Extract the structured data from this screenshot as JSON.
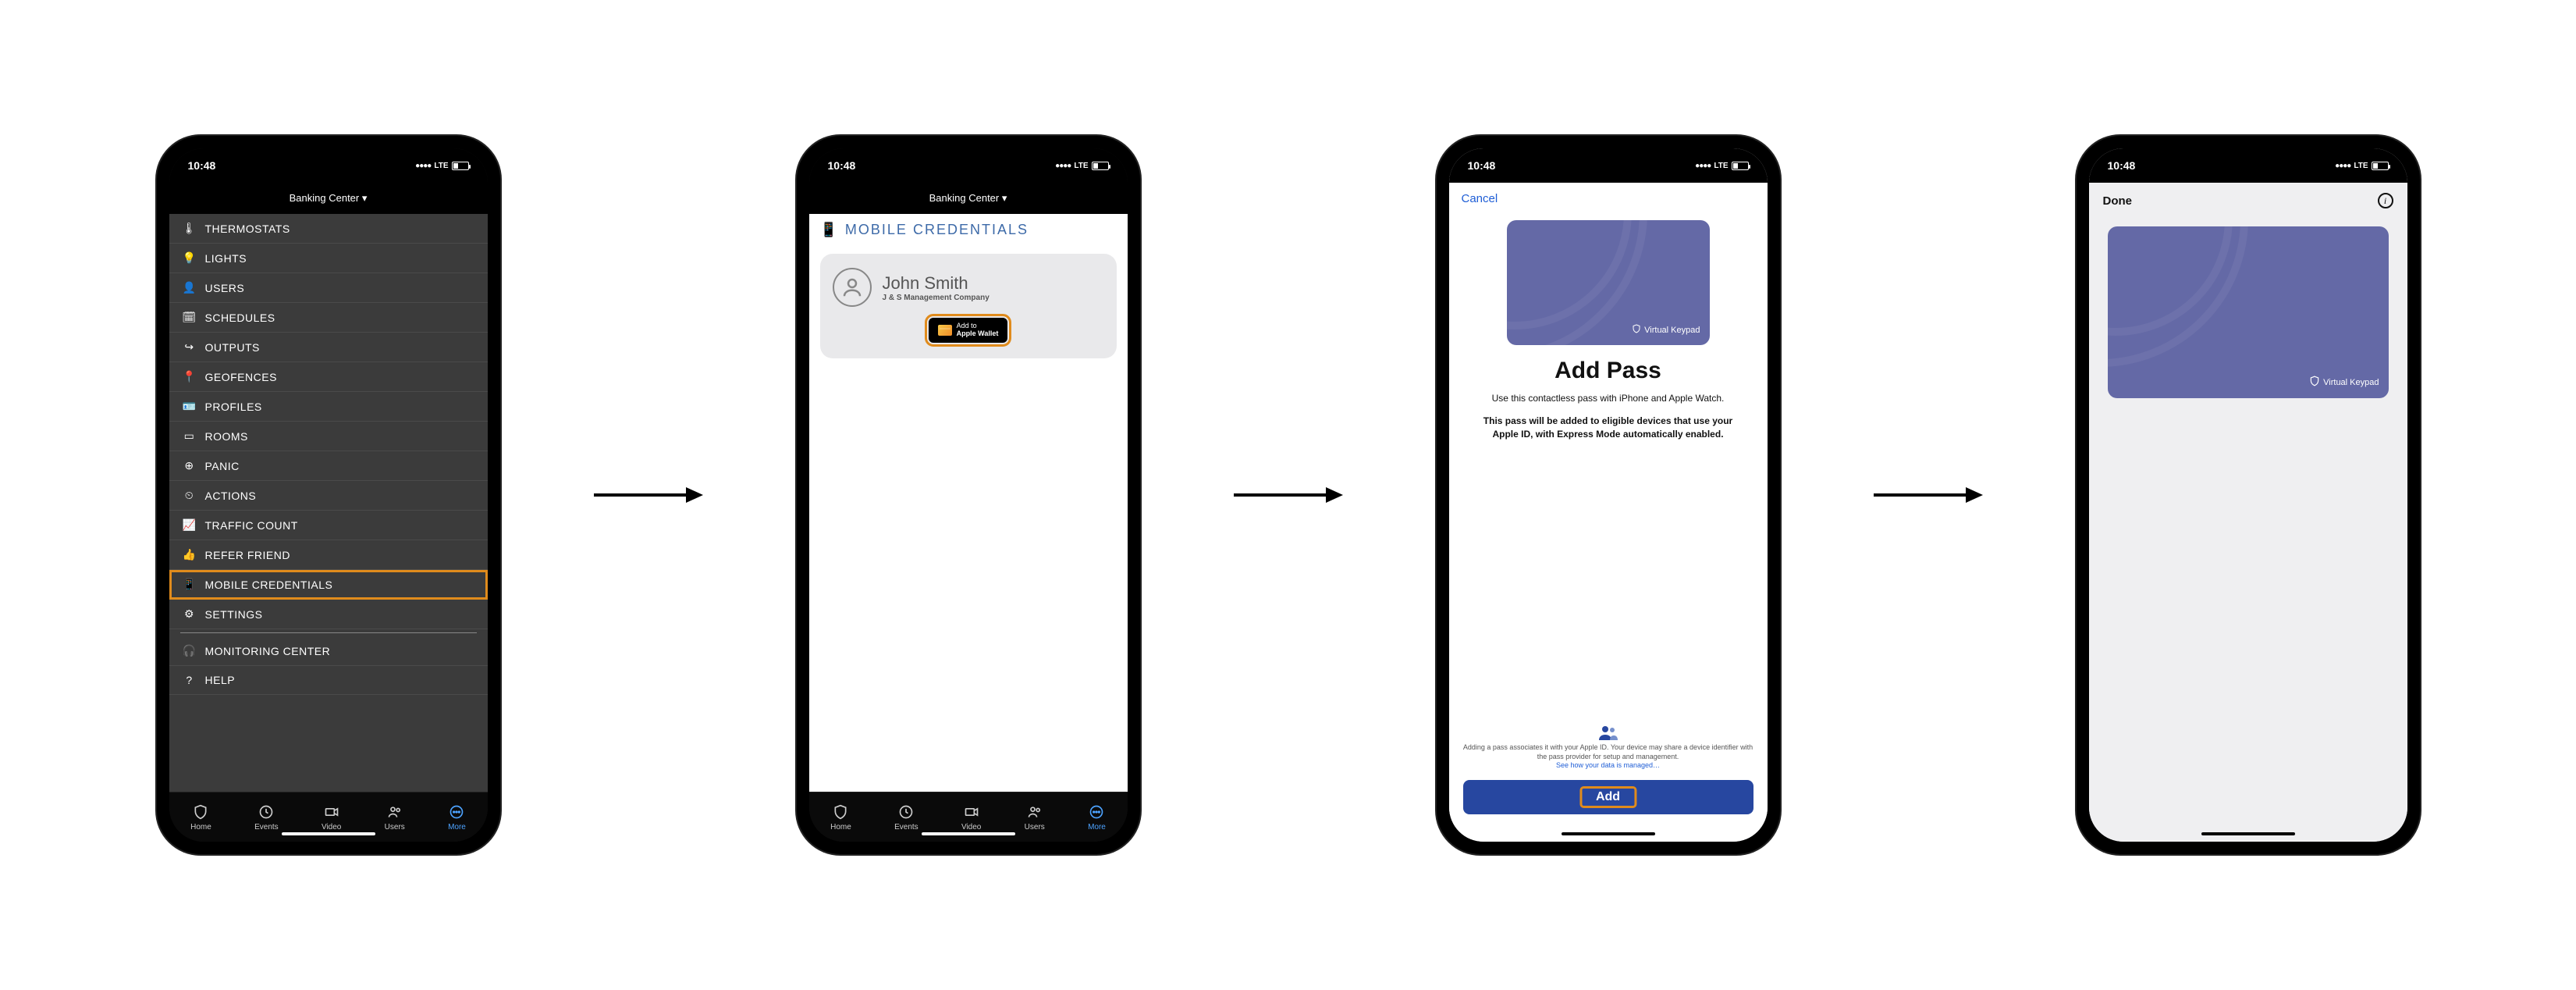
{
  "status": {
    "time": "10:48",
    "network": "LTE",
    "signal": "●●●●"
  },
  "header": {
    "location": "Banking Center ▾"
  },
  "menu": {
    "items": [
      {
        "icon": "thermometer-icon",
        "glyph": "🌡",
        "label": "THERMOSTATS"
      },
      {
        "icon": "lightbulb-icon",
        "glyph": "💡",
        "label": "LIGHTS"
      },
      {
        "icon": "user-icon",
        "glyph": "👤",
        "label": "USERS"
      },
      {
        "icon": "calendar-icon",
        "glyph": "🗓",
        "label": "SCHEDULES"
      },
      {
        "icon": "output-icon",
        "glyph": "↪",
        "label": "OUTPUTS"
      },
      {
        "icon": "pin-icon",
        "glyph": "📍",
        "label": "GEOFENCES"
      },
      {
        "icon": "card-icon",
        "glyph": "🪪",
        "label": "PROFILES"
      },
      {
        "icon": "room-icon",
        "glyph": "▭",
        "label": "ROOMS"
      },
      {
        "icon": "alert-icon",
        "glyph": "⊕",
        "label": "PANIC"
      },
      {
        "icon": "timer-icon",
        "glyph": "⏲",
        "label": "ACTIONS"
      },
      {
        "icon": "chart-icon",
        "glyph": "📈",
        "label": "TRAFFIC COUNT"
      },
      {
        "icon": "thumbs-up-icon",
        "glyph": "👍",
        "label": "REFER FRIEND"
      },
      {
        "icon": "phone-icon",
        "glyph": "📱",
        "label": "MOBILE CREDENTIALS",
        "highlight": true
      },
      {
        "icon": "gear-icon",
        "glyph": "⚙",
        "label": "SETTINGS",
        "separator_after": true
      },
      {
        "icon": "headset-icon",
        "glyph": "🎧",
        "label": "MONITORING CENTER"
      },
      {
        "icon": "help-icon",
        "glyph": "?",
        "label": "HELP"
      }
    ]
  },
  "tabs": {
    "items": [
      {
        "name": "home",
        "label": "Home"
      },
      {
        "name": "events",
        "label": "Events"
      },
      {
        "name": "video",
        "label": "Video"
      },
      {
        "name": "users",
        "label": "Users"
      },
      {
        "name": "more",
        "label": "More",
        "active": true
      }
    ]
  },
  "credentials": {
    "heading": "MOBILE CREDENTIALS",
    "name": "John Smith",
    "company": "J & S Management Company",
    "wallet_btn_line1": "Add to",
    "wallet_btn_line2": "Apple Wallet"
  },
  "addpass": {
    "cancel": "Cancel",
    "card_brand": "Virtual Keypad",
    "title": "Add Pass",
    "subtitle": "Use this contactless pass with iPhone and Apple Watch.",
    "note": "This pass will be added to eligible devices that use your Apple ID, with Express Mode automatically enabled.",
    "legal1": "Adding a pass associates it with your Apple ID. Your device may share a device identifier with the pass provider for setup and management.",
    "legal_link": "See how your data is managed…",
    "add_btn": "Add"
  },
  "wallet_done": {
    "done": "Done",
    "card_brand": "Virtual Keypad"
  }
}
